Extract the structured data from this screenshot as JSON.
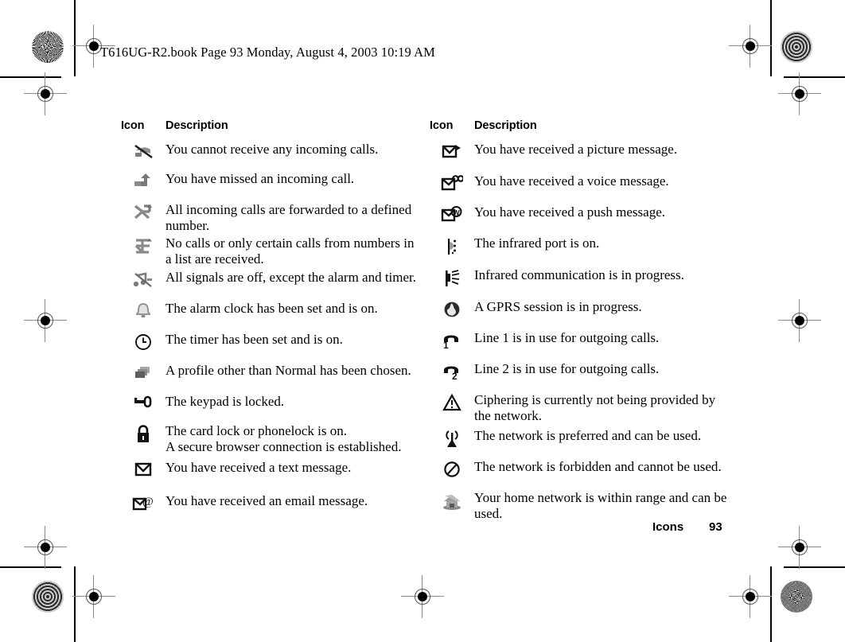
{
  "header": {
    "filename_line": "T616UG-R2.book  Page 93  Monday, August 4, 2003  10:19 AM"
  },
  "table_headers": {
    "icon": "Icon",
    "description": "Description"
  },
  "left_column": {
    "rows": [
      {
        "icon_name": "call-barred-icon",
        "desc_line1": "You cannot receive any incoming calls.",
        "desc_line2": ""
      },
      {
        "icon_name": "missed-call-icon",
        "desc_line1": "You have missed an incoming call.",
        "desc_line2": ""
      },
      {
        "icon_name": "call-forward-all-icon",
        "desc_line1": "All incoming calls are forwarded to a defined",
        "desc_line2": "number."
      },
      {
        "icon_name": "call-filter-icon",
        "desc_line1": "No calls or only certain calls from numbers in",
        "desc_line2": "a list are received."
      },
      {
        "icon_name": "silent-mode-icon",
        "desc_line1": "All signals are off, except the alarm and timer.",
        "desc_line2": ""
      },
      {
        "icon_name": "alarm-clock-icon",
        "desc_line1": "The alarm clock has been set and is on.",
        "desc_line2": ""
      },
      {
        "icon_name": "timer-icon",
        "desc_line1": "The timer has been set and is on.",
        "desc_line2": ""
      },
      {
        "icon_name": "profile-icon",
        "desc_line1": "A profile other than Normal has been chosen.",
        "desc_line2": ""
      },
      {
        "icon_name": "keypad-lock-icon",
        "desc_line1": "The keypad is locked.",
        "desc_line2": ""
      },
      {
        "icon_name": "padlock-icon",
        "desc_line1": "The card lock or phonelock is on.",
        "desc_line2": "A secure browser connection is established."
      },
      {
        "icon_name": "text-message-icon",
        "desc_line1": "You have received a text message.",
        "desc_line2": ""
      },
      {
        "icon_name": "email-message-icon",
        "desc_line1": "You have received an email message.",
        "desc_line2": ""
      }
    ]
  },
  "right_column": {
    "rows": [
      {
        "icon_name": "picture-message-icon",
        "desc_line1": "You have received a picture message.",
        "desc_line2": ""
      },
      {
        "icon_name": "voice-message-icon",
        "desc_line1": "You have received a voice message.",
        "desc_line2": ""
      },
      {
        "icon_name": "push-message-icon",
        "desc_line1": "You have received a push message.",
        "desc_line2": ""
      },
      {
        "icon_name": "infrared-on-icon",
        "desc_line1": "The infrared port is on.",
        "desc_line2": ""
      },
      {
        "icon_name": "infrared-active-icon",
        "desc_line1": "Infrared communication is in progress.",
        "desc_line2": ""
      },
      {
        "icon_name": "gprs-session-icon",
        "desc_line1": "A GPRS session is in progress.",
        "desc_line2": ""
      },
      {
        "icon_name": "line-1-icon",
        "desc_line1": "Line 1 is in use for outgoing calls.",
        "desc_line2": ""
      },
      {
        "icon_name": "line-2-icon",
        "desc_line1": "Line 2 is in use for outgoing calls.",
        "desc_line2": ""
      },
      {
        "icon_name": "ciphering-warning-icon",
        "desc_line1": "Ciphering is currently not being provided by",
        "desc_line2": "the network."
      },
      {
        "icon_name": "preferred-network-icon",
        "desc_line1": "The network is preferred and can be used.",
        "desc_line2": ""
      },
      {
        "icon_name": "forbidden-network-icon",
        "desc_line1": "The network is forbidden and cannot be used.",
        "desc_line2": ""
      },
      {
        "icon_name": "home-network-icon",
        "desc_line1": "Your home network is within range and can be",
        "desc_line2": "used."
      }
    ]
  },
  "footer": {
    "section": "Icons",
    "page_number": "93"
  },
  "colors": {
    "text": "#000000",
    "background": "#ffffff",
    "icon_gray": "#8a8a8a",
    "registration_gray": "#8a8a8a"
  }
}
